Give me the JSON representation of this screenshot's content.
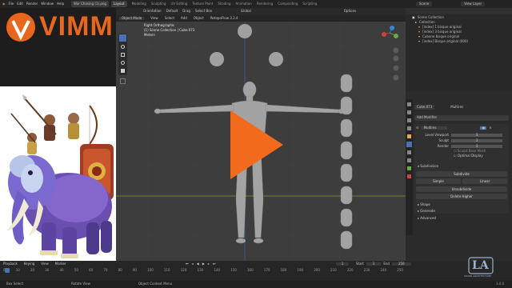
{
  "menu": [
    "File",
    "Edit",
    "Render",
    "Window",
    "Help"
  ],
  "file_tab": "War Chasing (1).png",
  "workspaces": [
    {
      "label": "Layout",
      "active": true
    },
    {
      "label": "Modeling",
      "active": false
    },
    {
      "label": "Sculpting",
      "active": false
    },
    {
      "label": "UV Editing",
      "active": false
    },
    {
      "label": "Texture Paint",
      "active": false
    },
    {
      "label": "Shading",
      "active": false
    },
    {
      "label": "Animation",
      "active": false
    },
    {
      "label": "Rendering",
      "active": false
    },
    {
      "label": "Compositing",
      "active": false
    },
    {
      "label": "Scripting",
      "active": false
    }
  ],
  "top_right": {
    "scene": "Scene",
    "view_layer": "View Layer"
  },
  "branding": {
    "logo_text": "VIMM",
    "logo_color": "#e8671c",
    "corner_mark": "LA",
    "corner_sub": "LEARN ARCHITECTURE"
  },
  "viewport_header": {
    "items": [
      "Orientation",
      "Default",
      "Drag",
      "Select Box",
      "Global",
      "Options"
    ]
  },
  "viewport_header2": {
    "items": [
      "Object Mode",
      "View",
      "Select",
      "Add",
      "Object",
      "RetopoFlow 3.2.4"
    ]
  },
  "viewport_info": {
    "line1": "Right Orthographic",
    "line2": "(1) Scene Collection | Cube.073",
    "line3": "Meters"
  },
  "outliner": {
    "title": "Scene Collection",
    "items": [
      "Collection",
      "[index] 1 bisque original",
      "[index] 3 bisque original",
      "Cubone bisque original",
      "[index] Bisque original (000)"
    ]
  },
  "properties": {
    "object": "Cube.073",
    "modifier_name": "Multires",
    "add_modifier": "Add Modifier",
    "modifier": "Multires",
    "fields": [
      {
        "label": "Level Viewport",
        "value": "3"
      },
      {
        "label": "Sculpt",
        "value": "3"
      },
      {
        "label": "Render",
        "value": "3"
      }
    ],
    "sculpt_base": "Sculpt Base Mesh",
    "optimal_display": "Optimal Display",
    "subdivision": "Subdivision",
    "buttons": [
      "Subdivide",
      "Simple",
      "Linear",
      "Unsubdivide",
      "Delete Higher"
    ],
    "sections": [
      "Shape",
      "Generate",
      "Advanced"
    ]
  },
  "timeline": {
    "menus": [
      "Playback",
      "Keying",
      "View",
      "Marker"
    ],
    "ticks": [
      "0",
      "10",
      "20",
      "30",
      "40",
      "50",
      "60",
      "70",
      "80",
      "90",
      "100",
      "110",
      "120",
      "130",
      "140",
      "150",
      "160",
      "170",
      "180",
      "190",
      "200",
      "210",
      "220",
      "230",
      "240",
      "250"
    ],
    "current_frame": "1",
    "start_label": "Start",
    "start": "1",
    "end_label": "End",
    "end": "250"
  },
  "statusbar": {
    "items": [
      "Box Select",
      "Rotate View",
      "Object Context Menu"
    ],
    "version": "3.0.0"
  }
}
